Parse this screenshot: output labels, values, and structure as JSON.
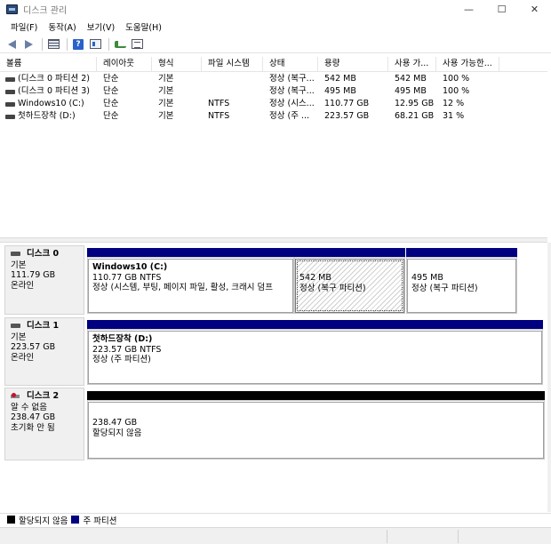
{
  "window": {
    "title": "디스크 관리",
    "app_icon": "disk-management-icon",
    "controls": [
      "—",
      "☐",
      "✕"
    ]
  },
  "menu": [
    "파일(F)",
    "동작(A)",
    "보기(V)",
    "도움말(H)"
  ],
  "toolbar": {
    "icons": [
      "back-arrow-icon",
      "forward-arrow-icon",
      "list-view-icon",
      "help-icon",
      "properties-icon",
      "connect-icon",
      "view-icon"
    ]
  },
  "volume_list": {
    "columns": [
      "볼륨",
      "레이아웃",
      "형식",
      "파일 시스템",
      "상태",
      "용량",
      "사용 가...",
      "사용 가능한..."
    ],
    "rows": [
      [
        "(디스크 0 파티션 2)",
        "단순",
        "기본",
        "",
        "정상 (복구...",
        "542 MB",
        "542 MB",
        "100 %"
      ],
      [
        "(디스크 0 파티션 3)",
        "단순",
        "기본",
        "",
        "정상 (복구...",
        "495 MB",
        "495 MB",
        "100 %"
      ],
      [
        "Windows10 (C:)",
        "단순",
        "기본",
        "NTFS",
        "정상 (시스...",
        "110.77 GB",
        "12.95 GB",
        "12 %"
      ],
      [
        "첫하드장착 (D:)",
        "단순",
        "기본",
        "NTFS",
        "정상 (주 ...",
        "223.57 GB",
        "68.21 GB",
        "31 %"
      ]
    ]
  },
  "disks": [
    {
      "name": "디스크 0",
      "icon": "disk-icon",
      "type": "기본",
      "size": "111.79 GB",
      "status": "온라인",
      "partitions": [
        {
          "name": "Windows10  (C:)",
          "size": "110.77 GB NTFS",
          "status": "정상 (시스템, 부팅, 페이지 파일, 활성, 크래시 덤프",
          "kind": "primary"
        },
        {
          "name": "",
          "size": "542 MB",
          "status": "정상 (복구 파티션)",
          "kind": "primary-selected"
        },
        {
          "name": "",
          "size": "495 MB",
          "status": "정상 (복구 파티션)",
          "kind": "primary"
        }
      ]
    },
    {
      "name": "디스크 1",
      "icon": "disk-icon",
      "type": "기본",
      "size": "223.57 GB",
      "status": "온라인",
      "partitions": [
        {
          "name": "첫하드장착  (D:)",
          "size": "223.57 GB NTFS",
          "status": "정상 (주 파티션)",
          "kind": "primary"
        }
      ]
    },
    {
      "name": "디스크 2",
      "icon": "unknown-disk-icon",
      "type": "알 수 없음",
      "size": "238.47 GB",
      "status": "초기화 안 됨",
      "partitions": [
        {
          "name": "",
          "size": "238.47 GB",
          "status": "할당되지 않음",
          "kind": "unallocated"
        }
      ]
    }
  ],
  "legend": [
    {
      "label": "할당되지 않음",
      "color": "#000000"
    },
    {
      "label": "주 파티션",
      "color": "#000080"
    }
  ],
  "colors": {
    "primary": "#000080",
    "unallocated": "#000000"
  }
}
